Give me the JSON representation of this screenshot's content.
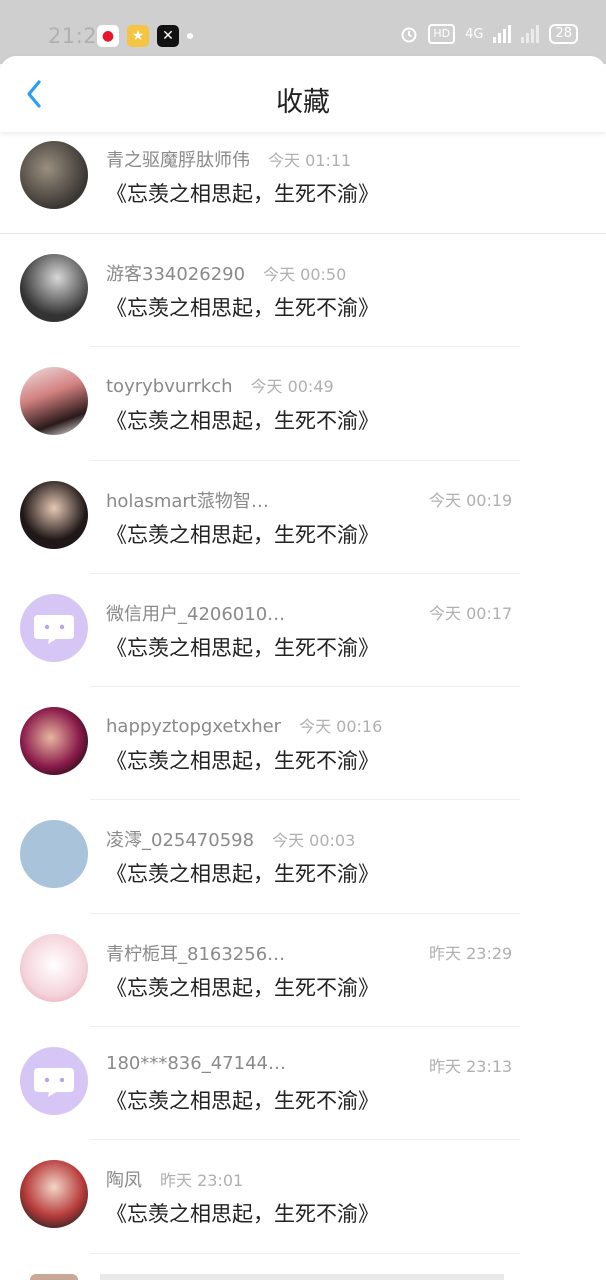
{
  "status": {
    "time": "21:25",
    "hd": "HD",
    "network": "4G",
    "battery": "28"
  },
  "header": {
    "title": "收藏"
  },
  "items": [
    {
      "name": "青之驱魔脬肽师伟",
      "time": "今天 01:11",
      "text": "《忘羡之相思起，生死不渝》"
    },
    {
      "name": "游客334026290",
      "time": "今天 00:50",
      "text": "《忘羡之相思起，生死不渝》"
    },
    {
      "name": "toyrybvurrkch",
      "time": "今天 00:49",
      "text": "《忘羡之相思起，生死不渝》"
    },
    {
      "name": "holasmart蒎物智…",
      "time": "今天 00:19",
      "text": "《忘羡之相思起，生死不渝》"
    },
    {
      "name": "微信用户_4206010…",
      "time": "今天 00:17",
      "text": "《忘羡之相思起，生死不渝》"
    },
    {
      "name": "happyztopgxetxher",
      "time": "今天 00:16",
      "text": "《忘羡之相思起，生死不渝》"
    },
    {
      "name": "凌澪_025470598",
      "time": "今天 00:03",
      "text": "《忘羡之相思起，生死不渝》"
    },
    {
      "name": "青柠栀耳_8163256…",
      "time": "昨天 23:29",
      "text": "《忘羡之相思起，生死不渝》"
    },
    {
      "name": "180***836_47144…",
      "time": "昨天 23:13",
      "text": "《忘羡之相思起，生死不渝》"
    },
    {
      "name": "陶凤",
      "time": "昨天 23:01",
      "text": "《忘羡之相思起，生死不渝》"
    }
  ],
  "colors": {
    "accent": "#2a9df4",
    "ghost_avatar": "#d6c6f6",
    "status_bar": "#cfcfcf"
  }
}
